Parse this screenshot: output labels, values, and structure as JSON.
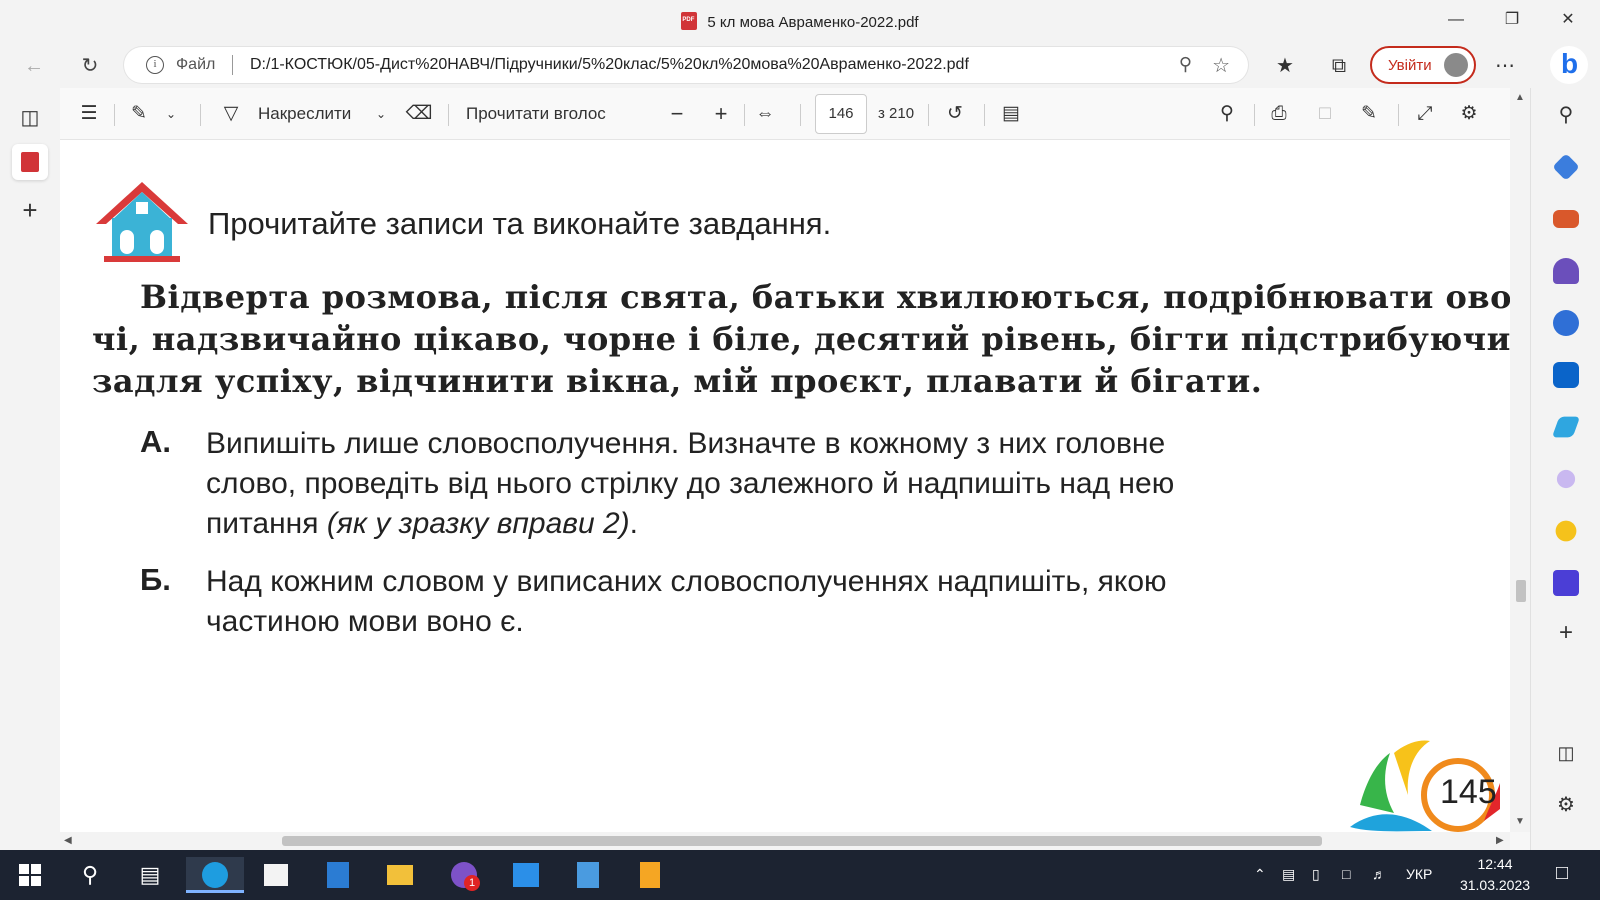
{
  "window": {
    "title": "5 кл мова Авраменко-2022.pdf"
  },
  "address_bar": {
    "file_label": "Файл",
    "url": "D:/1-КОСТЮК/05-Дист%20НАВЧ/Підручники/5%20клас/5%20кл%20мова%20Авраменко-2022.pdf",
    "signin_label": "Увійти"
  },
  "pdf_toolbar": {
    "draw_label": "Накреслити",
    "read_aloud_label": "Прочитати вголос",
    "page_current": "146",
    "page_total": "з 210"
  },
  "document": {
    "instruction": "Прочитайте записи та виконайте завдання.",
    "paragraph_lines": [
      "Відверта розмова, після свята, батьки хвилюються, подрібнювати ово-",
      "чі, надзвичайно цікаво, чорне і біле, десятий рівень, бігти підстрибуючи,",
      "задля успіху, відчинити вікна, мій проєкт, плавати й бігати."
    ],
    "task_a": {
      "label": "А.",
      "line1": "Випишіть лише словосполучення. Визначте в кожному з них головне",
      "line2": "слово, проведіть від нього стрілку до залежного й надпишіть над нею",
      "line3_start": "питання ",
      "line3_italic": "(як у зразку вправи 2)",
      "line3_end": "."
    },
    "task_b": {
      "label": "Б.",
      "line1": "Над кожним словом у виписаних словосполученнях надпишіть, якою",
      "line2": "частиною мови воно є."
    },
    "page_number": "145"
  },
  "taskbar": {
    "language": "УКР",
    "time": "12:44",
    "date": "31.03.2023",
    "viber_badge": "1"
  }
}
